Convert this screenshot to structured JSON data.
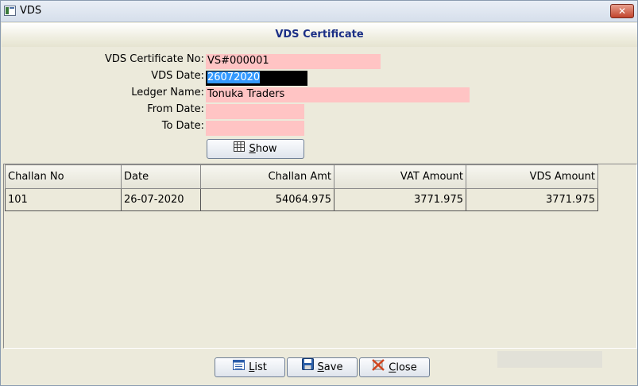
{
  "window": {
    "title": "VDS",
    "close_glyph": "✕"
  },
  "header": {
    "title": "VDS Certificate"
  },
  "form": {
    "certificate_no": {
      "label": "VDS Certificate No:",
      "value": "VS#000001"
    },
    "vds_date": {
      "label": "VDS Date:",
      "value": "26072020"
    },
    "ledger_name": {
      "label": "Ledger Name:",
      "value": "Tonuka Traders"
    },
    "from_date": {
      "label": "From Date:",
      "value": ""
    },
    "to_date": {
      "label": "To Date:",
      "value": ""
    },
    "field_color": "#ffc4c4"
  },
  "buttons": {
    "show": {
      "label_first": "S",
      "label_rest": "how",
      "icon": "table-icon"
    },
    "list": {
      "label_first": "L",
      "label_rest": "ist",
      "icon": "list-icon"
    },
    "save": {
      "label_first": "S",
      "label_rest": "ave",
      "icon": "floppy-disk-icon"
    },
    "close": {
      "label_first": "C",
      "label_rest": "lose",
      "icon": "close-icon"
    }
  },
  "table": {
    "columns": [
      "Challan No",
      "Date",
      "Challan Amt",
      "VAT Amount",
      "VDS Amount"
    ],
    "rows": [
      [
        "101",
        "26-07-2020",
        "54064.975",
        "3771.975",
        "3771.975"
      ]
    ]
  }
}
